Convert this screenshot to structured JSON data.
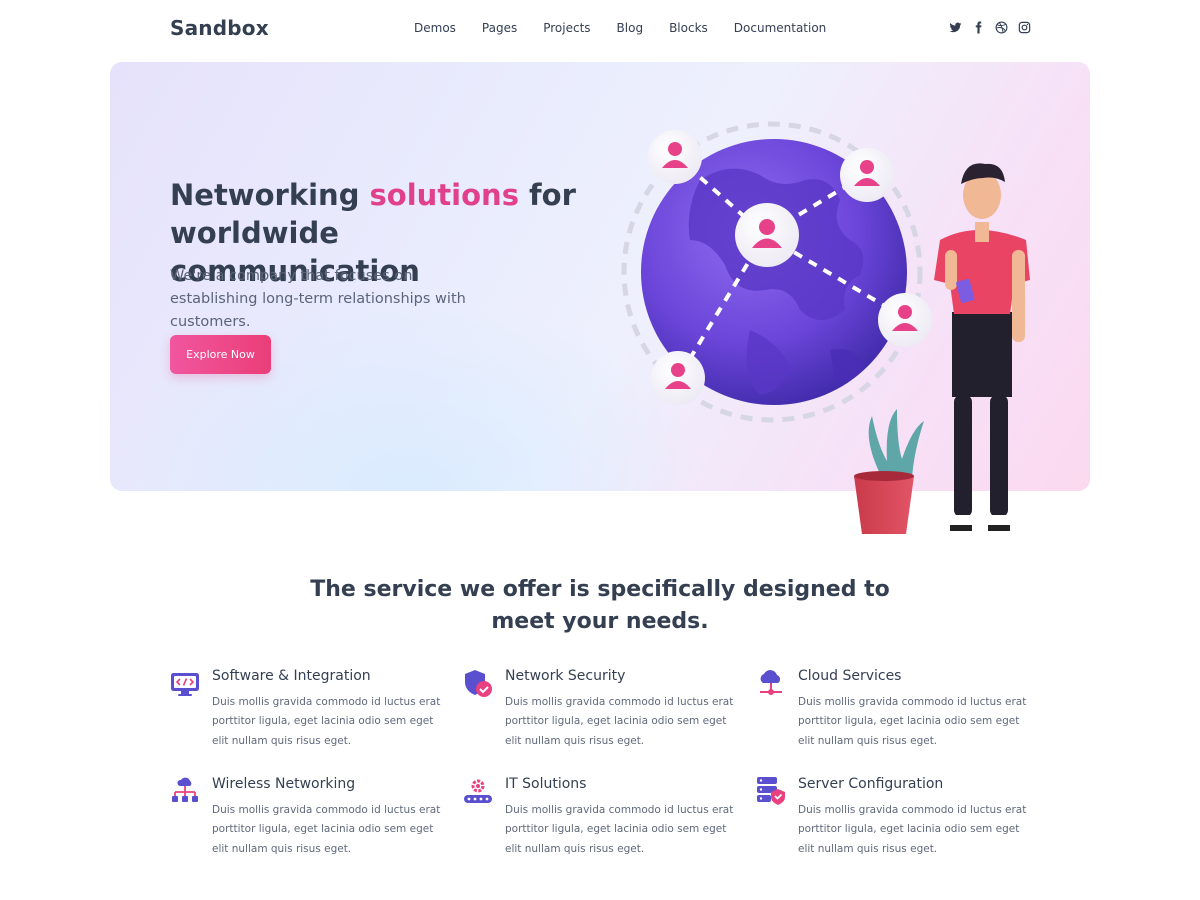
{
  "brand": {
    "name": "Sandbox"
  },
  "nav": {
    "items": [
      "Demos",
      "Pages",
      "Projects",
      "Blog",
      "Blocks",
      "Documentation"
    ]
  },
  "social": [
    "twitter-icon",
    "facebook-icon",
    "dribbble-icon",
    "instagram-icon"
  ],
  "hero": {
    "title_part1": "Networking ",
    "title_accent": "solutions",
    "title_part2": " for worldwide communication",
    "subtitle": "We're a company that focuses on establishing long-term relationships with customers.",
    "cta_label": "Explore Now"
  },
  "services_section": {
    "title": "The service we offer is specifically designed to meet your needs.",
    "items": [
      {
        "name": "Software & Integration",
        "desc": "Duis mollis gravida commodo id luctus erat porttitor ligula, eget lacinia odio sem eget elit nullam quis risus eget.",
        "icon": "monitor-code-icon"
      },
      {
        "name": "Network Security",
        "desc": "Duis mollis gravida commodo id luctus erat porttitor ligula, eget lacinia odio sem eget elit nullam quis risus eget.",
        "icon": "shield-check-icon"
      },
      {
        "name": "Cloud Services",
        "desc": "Duis mollis gravida commodo id luctus erat porttitor ligula, eget lacinia odio sem eget elit nullam quis risus eget.",
        "icon": "cloud-network-icon"
      },
      {
        "name": "Wireless Networking",
        "desc": "Duis mollis gravida commodo id luctus erat porttitor ligula, eget lacinia odio sem eget elit nullam quis risus eget.",
        "icon": "network-tree-icon"
      },
      {
        "name": "IT Solutions",
        "desc": "Duis mollis gravida commodo id luctus erat porttitor ligula, eget lacinia odio sem eget elit nullam quis risus eget.",
        "icon": "gear-conveyor-icon"
      },
      {
        "name": "Server Configuration",
        "desc": "Duis mollis gravida commodo id luctus erat porttitor ligula, eget lacinia odio sem eget elit nullam quis risus eget.",
        "icon": "server-shield-icon"
      }
    ]
  },
  "colors": {
    "accent": "#e1408c",
    "text": "#343f52",
    "muted": "#60697b",
    "icon_purple": "#5a4fcf",
    "icon_pink": "#e9417f"
  }
}
